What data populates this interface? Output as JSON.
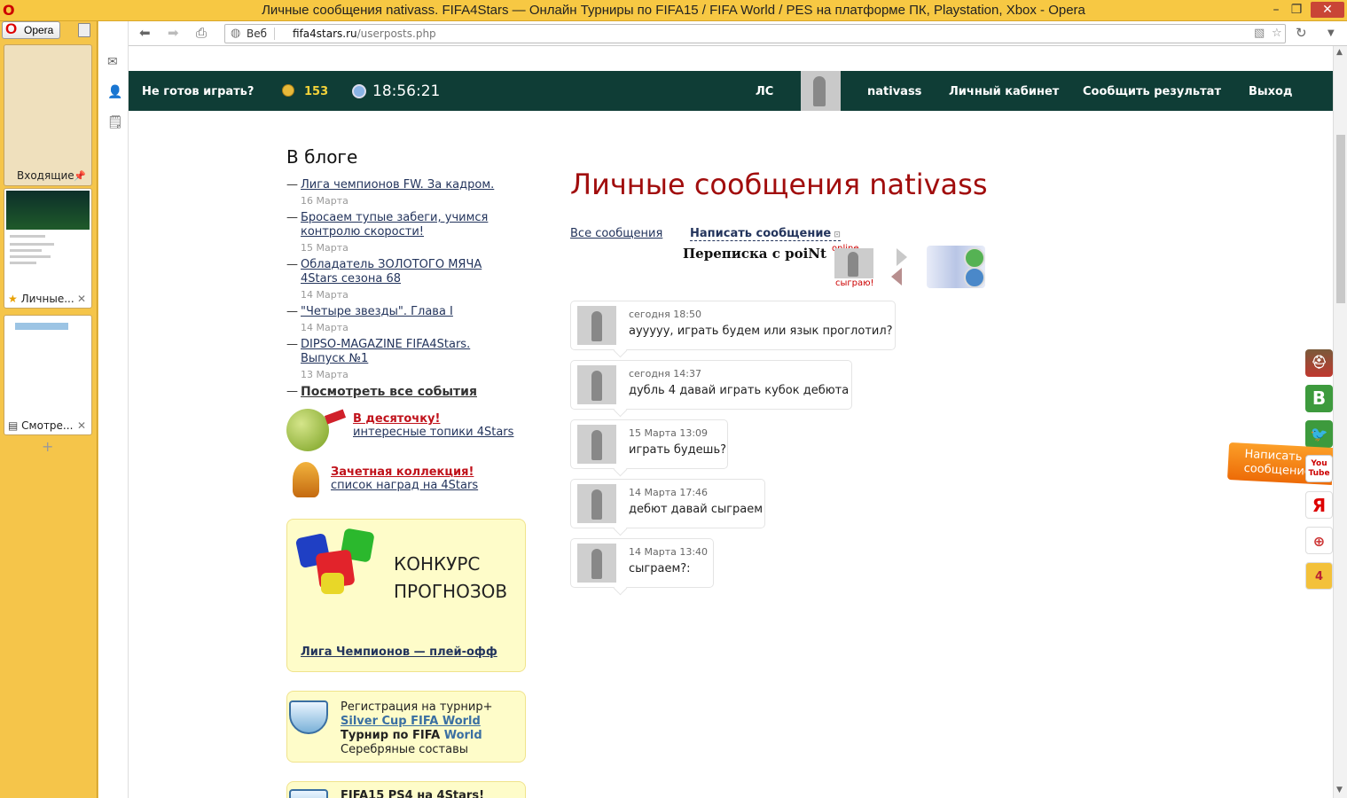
{
  "window": {
    "title": "Личные сообщения nativass. FIFA4Stars — Онлайн Турниры по FIFA15 / FIFA World / PES на платформе ПК, Playstation, Xbox - Opera"
  },
  "opera_panel": {
    "menu_label": "Opera",
    "inbox_label": "Входящие",
    "tabs": [
      {
        "label": "Личные..."
      },
      {
        "label": "Смотре..."
      }
    ]
  },
  "addressbar": {
    "web_label": "Веб",
    "domain": "fifa4stars.ru",
    "path": "/userposts.php"
  },
  "site_header": {
    "status": "Не готов играть?",
    "coins": "153",
    "time": "18:56:21",
    "nav": {
      "pm": "ЛС",
      "user": "nativass",
      "cabinet": "Личный кабинет",
      "report": "Сообщить результат",
      "logout": "Выход"
    }
  },
  "blog": {
    "heading": "В блоге",
    "items": [
      {
        "title": "Лига чемпионов FW. За кадром.",
        "date": "16 Марта"
      },
      {
        "title": "Бросаем тупые забеги, учимся контролю скорости!",
        "date": "15 Марта"
      },
      {
        "title": "Обладатель ЗОЛОТОГО МЯЧА 4Stars сезона 68",
        "date": "14 Марта"
      },
      {
        "title": "\"Четыре звезды\". Глава I",
        "date": "14 Марта"
      },
      {
        "title": "DIPSO-MAGAZINE FIFA4Stars. Выпуск №1",
        "date": "13 Марта"
      }
    ],
    "all_link": "Посмотреть все события"
  },
  "promos": {
    "top": {
      "title": "В десяточку!",
      "sub": "интересные топики 4Stars"
    },
    "awards": {
      "title": "Зачетная коллекция!",
      "sub": "список наград на 4Stars"
    }
  },
  "contest": {
    "line1": "КОНКУРС",
    "line2": "ПРОГНОЗОВ",
    "link": "Лига Чемпионов — плей-офф"
  },
  "registration": {
    "line1": "Регистрация на турнир+",
    "cup": "Silver Cup FIFA World",
    "line3a": "Турнир по FIFA ",
    "line3b": "World",
    "line4": "Серебряные составы"
  },
  "next_box": {
    "text": "FIFA15 PS4 на 4Stars!"
  },
  "pm": {
    "title": "Личные сообщения nativass",
    "all_label": "Все сообщения",
    "write_label": "Написать сообщение",
    "conversation": "Переписка с poiNt",
    "online": "online",
    "play": "сыграю!",
    "messages": [
      {
        "time": "сегодня 18:50",
        "text": "ayyyyy, играть будем или язык проглотил?"
      },
      {
        "time": "сегодня 14:37",
        "text": "дубль 4 давай играть кубок дебюта"
      },
      {
        "time": "15 Марта 13:09",
        "text": "играть будешь?"
      },
      {
        "time": "14 Марта 17:46",
        "text": "дебют давай сыграем"
      },
      {
        "time": "14 Марта 13:40",
        "text": "сыграем?:"
      }
    ]
  },
  "widgets": {
    "write_tab": "Написать сообщение",
    "vk": "B",
    "ya": "Я",
    "youtube": "You Tube",
    "star": "4"
  },
  "colors": {
    "header_bg": "#0f3d36",
    "title_red": "#a10d0d",
    "link_blue": "#23345c",
    "panel_yellow": "#f5c54a"
  }
}
